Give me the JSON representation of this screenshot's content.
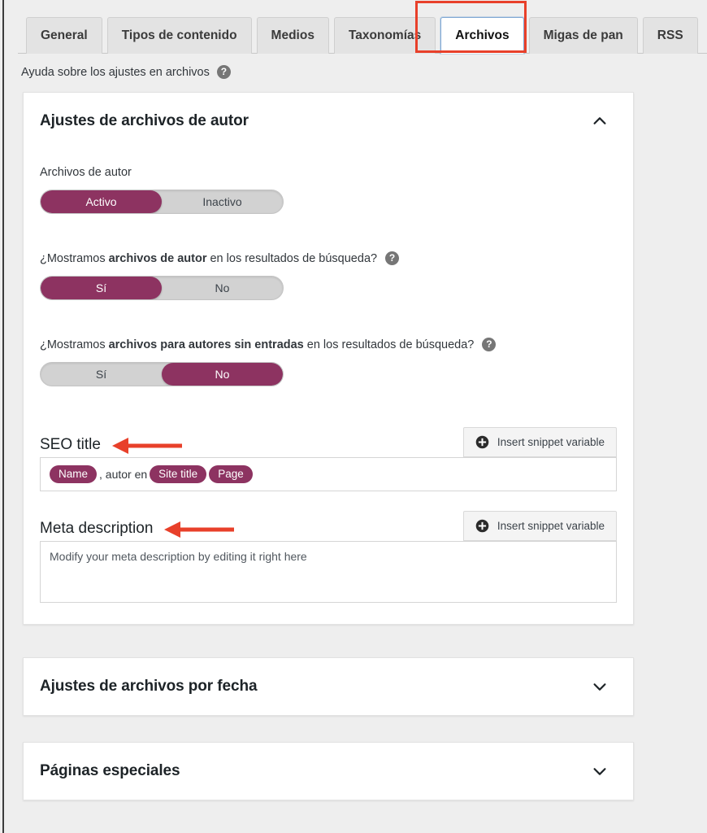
{
  "tabs": [
    {
      "label": "General",
      "active": false
    },
    {
      "label": "Tipos de contenido",
      "active": false
    },
    {
      "label": "Medios",
      "active": false
    },
    {
      "label": "Taxonomías",
      "active": false
    },
    {
      "label": "Archivos",
      "active": true
    },
    {
      "label": "Migas de pan",
      "active": false
    },
    {
      "label": "RSS",
      "active": false
    }
  ],
  "help": {
    "text": "Ayuda sobre los ajustes en archivos",
    "icon": "question-mark-icon",
    "icon_glyph": "?"
  },
  "annotations": {
    "tab_highlight_color": "#e8402a",
    "arrow_color": "#e8402a"
  },
  "colors": {
    "accent": "#8d3361",
    "page_background": "#eeeeee",
    "card_background": "#ffffff",
    "toggle_track": "#d2d2d2",
    "active_tab_border": "#7fa8d4"
  },
  "author_archives_panel": {
    "title": "Ajustes de archivos de autor",
    "expanded": true,
    "chevron": "chevron-up-icon",
    "author_archives": {
      "label": "Archivos de autor",
      "options": [
        "Activo",
        "Inactivo"
      ],
      "selected": "Activo"
    },
    "show_in_search": {
      "label_prefix": "¿Mostramos ",
      "label_bold": "archivos de autor",
      "label_suffix": " en los resultados de búsqueda?",
      "help_icon": "question-mark-icon",
      "options": [
        "Sí",
        "No"
      ],
      "selected": "Sí"
    },
    "show_authors_without_posts": {
      "label_prefix": "¿Mostramos ",
      "label_bold": "archivos para autores sin entradas",
      "label_suffix": " en los resultados de búsqueda?",
      "help_icon": "question-mark-icon",
      "options": [
        "Sí",
        "No"
      ],
      "selected": "No"
    },
    "seo_title": {
      "label": "SEO title",
      "snippet_button": "Insert snippet variable",
      "snippet_icon": "plus-circle-icon",
      "value_parts": [
        {
          "type": "pill",
          "text": "Name"
        },
        {
          "type": "text",
          "text": ", autor en "
        },
        {
          "type": "pill",
          "text": "Site title"
        },
        {
          "type": "text",
          "text": " "
        },
        {
          "type": "pill",
          "text": "Page"
        }
      ],
      "has_arrow_annotation": true
    },
    "meta_description": {
      "label": "Meta description",
      "snippet_button": "Insert snippet variable",
      "snippet_icon": "plus-circle-icon",
      "value": "Modify your meta description by editing it right here",
      "has_arrow_annotation": true
    }
  },
  "date_archives_panel": {
    "title": "Ajustes de archivos por fecha",
    "expanded": false,
    "chevron": "chevron-down-icon"
  },
  "special_pages_panel": {
    "title": "Páginas especiales",
    "expanded": false,
    "chevron": "chevron-down-icon"
  }
}
